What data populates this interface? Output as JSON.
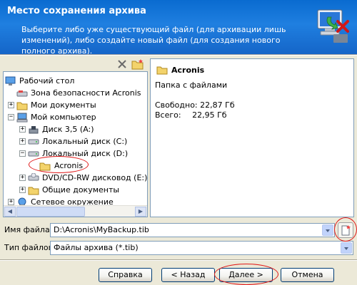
{
  "header": {
    "title": "Место сохранения архива",
    "subtitle": "Выберите либо уже существующий файл (для архивации лишь изменений), либо создайте новый файл (для создания нового полного архива)."
  },
  "tree": {
    "items": [
      {
        "label": "Рабочий стол",
        "icon": "desktop-icon"
      },
      {
        "label": "Зона безопасности Acronis",
        "icon": "secure-zone-icon"
      },
      {
        "label": "Мои документы",
        "icon": "folder-icon"
      },
      {
        "label": "Мой компьютер",
        "icon": "computer-icon"
      },
      {
        "label": "Диск 3,5 (A:)",
        "icon": "floppy-icon"
      },
      {
        "label": "Локальный диск (C:)",
        "icon": "hard-drive-icon"
      },
      {
        "label": "Локальный диск (D:)",
        "icon": "hard-drive-icon"
      },
      {
        "label": "Acronis",
        "icon": "folder-open-icon"
      },
      {
        "label": "DVD/CD-RW дисковод (E:) У",
        "icon": "cd-drive-icon"
      },
      {
        "label": "Общие документы",
        "icon": "folder-icon"
      },
      {
        "label": "Сетевое окружение",
        "icon": "network-icon"
      }
    ]
  },
  "info": {
    "name": "Acronis",
    "type": "Папка с файлами",
    "free_label": "Свободно:",
    "free_value": "22,87 Гб",
    "total_label": "Всего:",
    "total_value": "22,95 Гб"
  },
  "form": {
    "filename_label": "Имя файла:",
    "filename_value": "D:\\Acronis\\MyBackup.tib",
    "filetype_label": "Тип файлов:",
    "filetype_value": "Файлы архива (*.tib)"
  },
  "buttons": {
    "help": "Справка",
    "back": "< Назад",
    "next": "Далее >",
    "cancel": "Отмена"
  },
  "colors": {
    "header": "#1f7fe0",
    "dialog": "#ECE9D8",
    "highlight": "#e01818"
  }
}
